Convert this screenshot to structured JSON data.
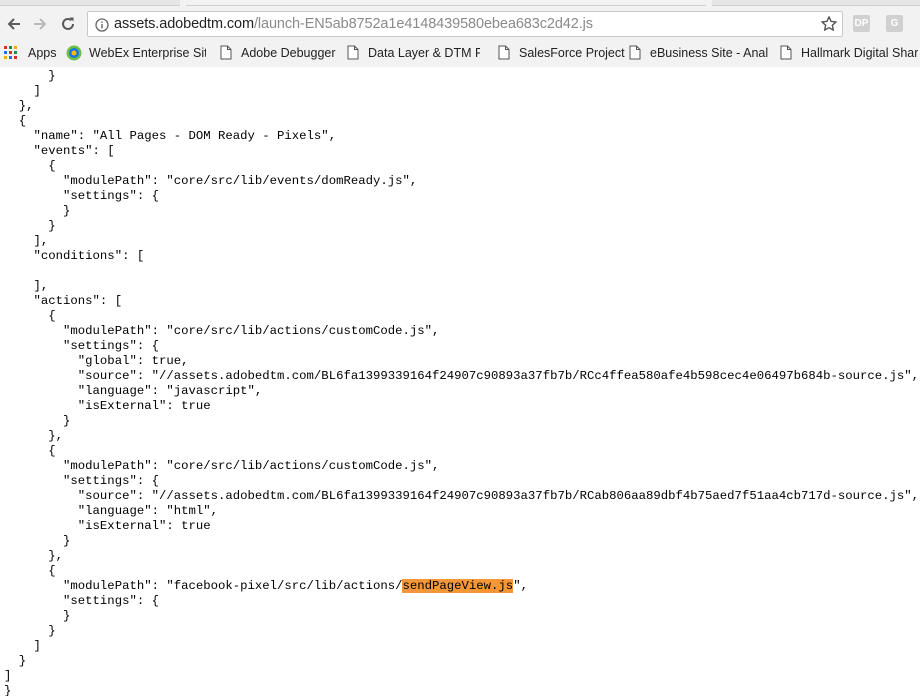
{
  "browser": {
    "url_host": "assets.adobedtm.com",
    "url_path": "/launch-EN5ab8752a1e4148439580ebea683c2d42.js",
    "extensions": [
      "DP",
      "G"
    ]
  },
  "bookmarks": {
    "apps_label": "Apps",
    "items": [
      {
        "label": "WebEx Enterprise Site",
        "icon": "webex-logo-icon"
      },
      {
        "label": "Adobe Debugger",
        "icon": "page-icon"
      },
      {
        "label": "Data Layer & DTM Pr",
        "icon": "page-icon"
      },
      {
        "label": "SalesForce Project",
        "icon": "page-icon"
      },
      {
        "label": "eBusiness Site - Analy",
        "icon": "page-icon"
      },
      {
        "label": "Hallmark Digital Shar",
        "icon": "page-icon"
      }
    ]
  },
  "code": {
    "highlight_color": "#f59737",
    "lines": [
      "      }",
      "    ]",
      "  },",
      "  {",
      "    \"name\": \"All Pages - DOM Ready - Pixels\",",
      "    \"events\": [",
      "      {",
      "        \"modulePath\": \"core/src/lib/events/domReady.js\",",
      "        \"settings\": {",
      "        }",
      "      }",
      "    ],",
      "    \"conditions\": [",
      "",
      "    ],",
      "    \"actions\": [",
      "      {",
      "        \"modulePath\": \"core/src/lib/actions/customCode.js\",",
      "        \"settings\": {",
      "          \"global\": true,",
      "          \"source\": \"//assets.adobedtm.com/BL6fa1399339164f24907c90893a37fb7b/RCc4ffea580afe4b598cec4e06497b684b-source.js\",",
      "          \"language\": \"javascript\",",
      "          \"isExternal\": true",
      "        }",
      "      },",
      "      {",
      "        \"modulePath\": \"core/src/lib/actions/customCode.js\",",
      "        \"settings\": {",
      "          \"source\": \"//assets.adobedtm.com/BL6fa1399339164f24907c90893a37fb7b/RCab806aa89dbf4b75aed7f51aa4cb717d-source.js\",",
      "          \"language\": \"html\",",
      "          \"isExternal\": true",
      "        }",
      "      },",
      "      {",
      "        \"modulePath\": \"facebook-pixel/src/lib/actions/",
      "        \"settings\": {",
      "        }",
      "      }",
      "    ]",
      "  }",
      "]",
      "}"
    ],
    "highlight": {
      "line_index": 34,
      "matched_text": "sendPageView.js",
      "after_text": "\","
    }
  }
}
